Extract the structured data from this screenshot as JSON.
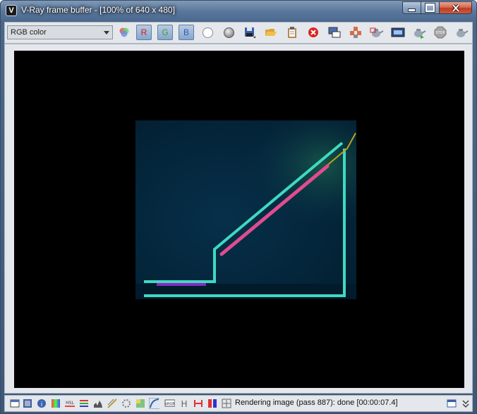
{
  "window": {
    "title": "V-Ray frame buffer - [100% of 640 x 480]"
  },
  "toolbar": {
    "channel_select": "RGB color",
    "r_label": "R",
    "g_label": "G",
    "b_label": "B",
    "icons": [
      "channels-icon",
      "red-channel",
      "green-channel",
      "blue-channel",
      "white-circle-icon",
      "gray-circle-icon",
      "save-icon",
      "open-icon",
      "clipboard-icon",
      "clear-icon",
      "region-icon",
      "link-icon",
      "teapot-icon",
      "vfb-icon",
      "teapot-render-icon",
      "stop-icon",
      "teapot-settings-icon"
    ]
  },
  "status": {
    "text": "Rendering image (pass 887): done [00:00:07.4]"
  },
  "colors": {
    "cyan": "#3fd9c2",
    "pink": "#e14c8e",
    "purple": "#8b28c6",
    "bg": "#052a40"
  }
}
